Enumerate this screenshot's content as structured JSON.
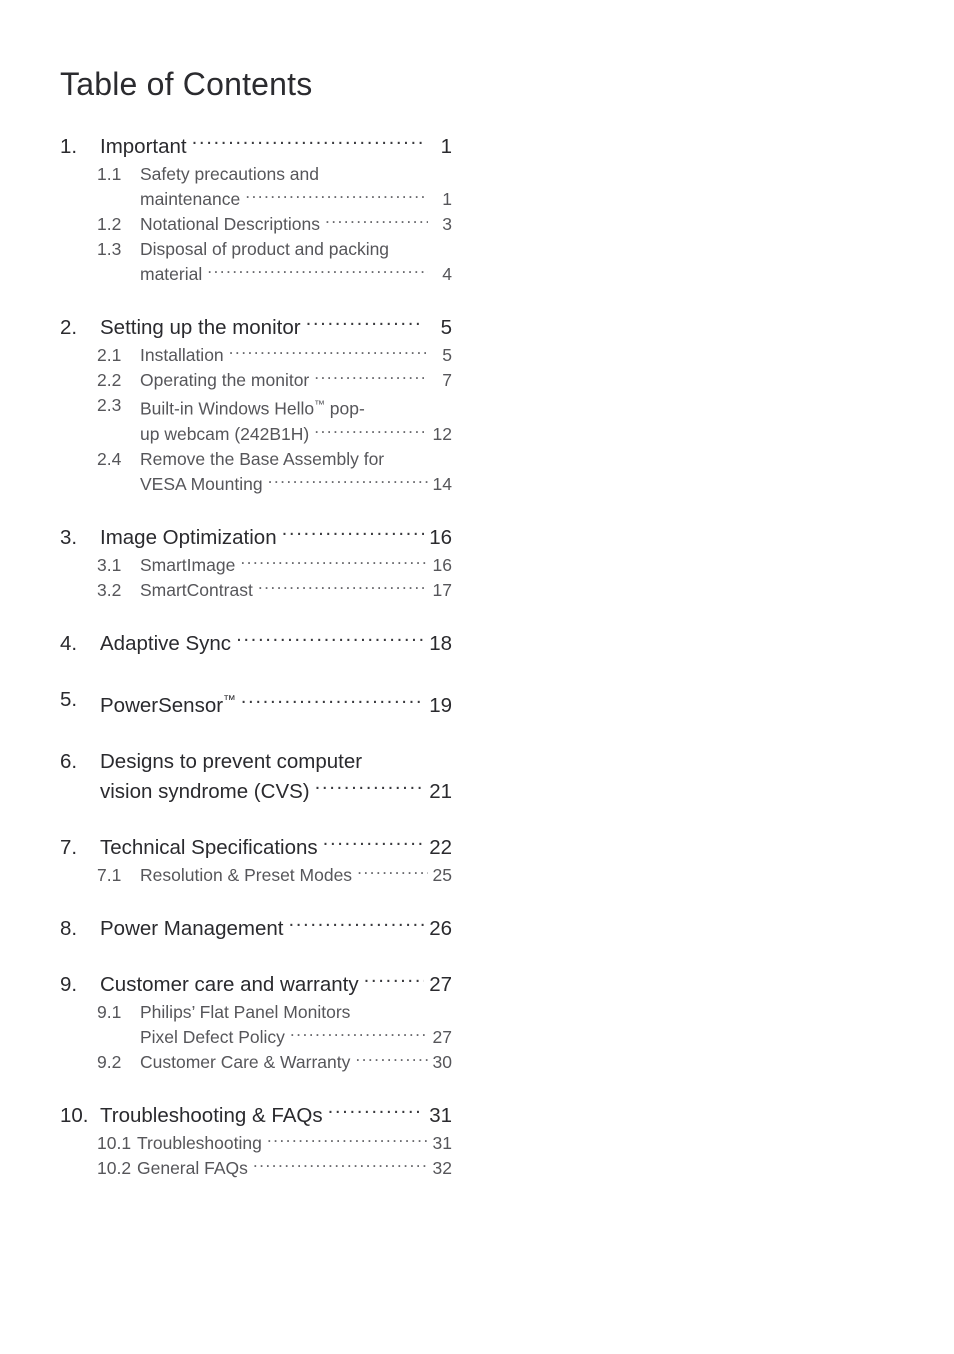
{
  "document": {
    "title": "Table of Contents",
    "background_color": "#ffffff",
    "main_entry_color": "#2a2a2e",
    "sub_entry_color": "#56565a"
  },
  "toc": {
    "groups": [
      {
        "number": "1.",
        "title": "Important",
        "page": "1",
        "subs": [
          {
            "number": "1.1",
            "title": "Safety precautions and",
            "title_line2": "maintenance",
            "page": "1"
          },
          {
            "number": "1.2",
            "title": "Notational Descriptions",
            "page": "3"
          },
          {
            "number": "1.3",
            "title": "Disposal of product and packing",
            "title_line2": "material",
            "page": "4"
          }
        ]
      },
      {
        "number": "2.",
        "title": "Setting up the monitor",
        "page": "5",
        "subs": [
          {
            "number": "2.1",
            "title": "Installation",
            "page": "5"
          },
          {
            "number": "2.2",
            "title": "Operating the monitor",
            "page": "7"
          },
          {
            "number": "2.3",
            "title": "Built-in Windows Hello™ pop-",
            "title_line2": "up webcam (242B1H)",
            "page": "12"
          },
          {
            "number": "2.4",
            "title": "Remove the Base Assembly for",
            "title_line2": "VESA Mounting",
            "page": "14"
          }
        ]
      },
      {
        "number": "3.",
        "title": "Image Optimization",
        "page": "16",
        "subs": [
          {
            "number": "3.1",
            "title": "SmartImage",
            "page": "16"
          },
          {
            "number": "3.2",
            "title": "SmartContrast",
            "page": "17"
          }
        ]
      },
      {
        "number": "4.",
        "title": "Adaptive Sync",
        "page": "18",
        "subs": []
      },
      {
        "number": "5.",
        "title": "PowerSensor™",
        "page": "19",
        "subs": []
      },
      {
        "number": "6.",
        "title": "Designs to prevent computer",
        "title_line2": "vision syndrome (CVS)",
        "page": "21",
        "subs": []
      },
      {
        "number": "7.",
        "title": "Technical Specifications",
        "page": "22",
        "subs": [
          {
            "number": "7.1",
            "title": "Resolution & Preset Modes",
            "page": "25"
          }
        ]
      },
      {
        "number": "8.",
        "title": "Power Management",
        "page": "26",
        "subs": []
      },
      {
        "number": "9.",
        "title": "Customer care and warranty",
        "page": "27",
        "subs": [
          {
            "number": "9.1",
            "title": "Philips’ Flat Panel Monitors",
            "title_line2": "Pixel Defect Policy",
            "page": "27"
          },
          {
            "number": "9.2",
            "title": "Customer Care & Warranty",
            "page": "30"
          }
        ]
      },
      {
        "number": "10.",
        "title": "Troubleshooting & FAQs",
        "page": "31",
        "subs": [
          {
            "number": "10.1",
            "title": "Troubleshooting",
            "page": "31"
          },
          {
            "number": "10.2",
            "title": "General FAQs",
            "page": "32"
          }
        ]
      }
    ]
  }
}
